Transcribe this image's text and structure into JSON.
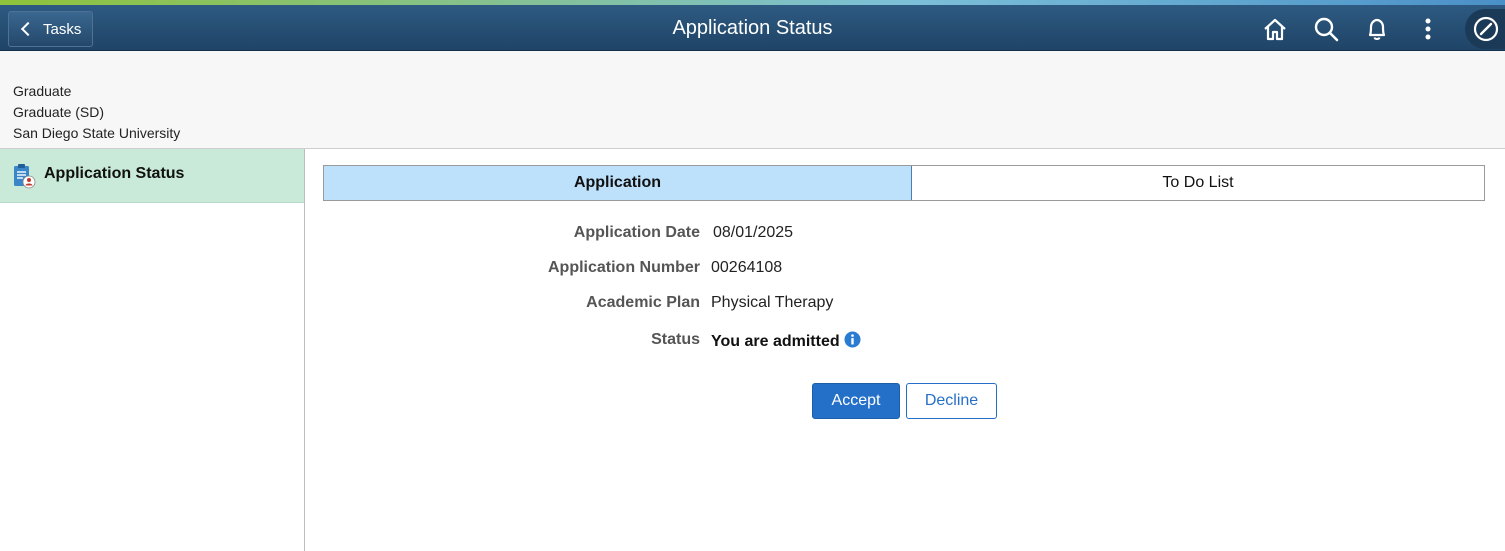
{
  "header": {
    "back_label": "Tasks",
    "title": "Application Status",
    "icons": [
      "home-icon",
      "search-icon",
      "bell-icon",
      "more-vertical-icon",
      "navbar-compass-icon"
    ]
  },
  "context": {
    "line1": "Graduate",
    "line2": "Graduate (SD)",
    "line3": "San Diego State University"
  },
  "sidebar": {
    "items": [
      {
        "label": "Application Status",
        "icon": "application-clipboard-icon",
        "active": true
      }
    ]
  },
  "tabs": [
    {
      "label": "Application",
      "active": true
    },
    {
      "label": "To Do List",
      "active": false
    }
  ],
  "fields": {
    "application_date": {
      "label": "Application Date",
      "value": "08/01/2025"
    },
    "application_number": {
      "label": "Application Number",
      "value": "00264108"
    },
    "academic_plan": {
      "label": "Academic Plan",
      "value": "Physical Therapy"
    },
    "status": {
      "label": "Status",
      "value": "You are admitted"
    }
  },
  "actions": {
    "accept_label": "Accept",
    "decline_label": "Decline"
  },
  "colors": {
    "header": "#24486b",
    "active_tab": "#bde0fb",
    "sidebar_active": "#c9ead9",
    "primary": "#2470c9"
  }
}
